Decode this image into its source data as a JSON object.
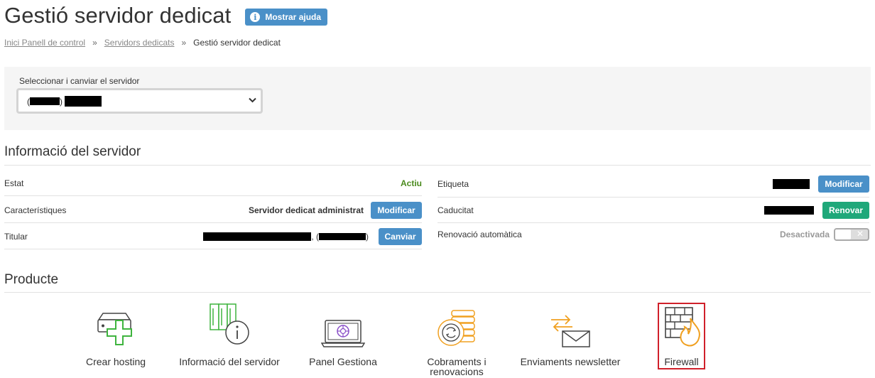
{
  "header": {
    "title": "Gestió servidor dedicat",
    "help_label": "Mostrar ajuda",
    "help_icon": "info-icon"
  },
  "breadcrumb": {
    "items": [
      "Inici Panell de control",
      "Servidors dedicats",
      "Gestió servidor dedicat"
    ],
    "separator": "»"
  },
  "server_selector": {
    "label": "Seleccionar i canviar el servidor",
    "value_prefix": "(",
    "value_close": ")"
  },
  "server_info": {
    "title": "Informació del servidor",
    "left": [
      {
        "label": "Estat",
        "value": "Actiu"
      },
      {
        "label": "Característiques",
        "value": "Servidor dedicat administrat",
        "button": "Modificar"
      },
      {
        "label": "Titular",
        "value_sep": ", (",
        "value_close": ")",
        "button": "Canviar"
      }
    ],
    "right": [
      {
        "label": "Etiqueta",
        "button": "Modificar"
      },
      {
        "label": "Caducitat",
        "button": "Renovar"
      },
      {
        "label": "Renovació automàtica",
        "value": "Desactivada",
        "toggle_symbol": "✕"
      }
    ]
  },
  "products": {
    "title": "Producte",
    "items": [
      {
        "label": "Crear hosting",
        "icon": "server-add-icon"
      },
      {
        "label": "Informació del servidor",
        "icon": "server-info-icon"
      },
      {
        "label": "Panel Gestiona",
        "icon": "laptop-panel-icon"
      },
      {
        "label_line1": "Cobraments i",
        "label_line2": "renovacions",
        "icon": "coins-icon"
      },
      {
        "label": "Enviaments newsletter",
        "icon": "newsletter-icon"
      },
      {
        "label": "Firewall",
        "icon": "firewall-icon"
      }
    ]
  },
  "colors": {
    "accent_blue": "#4a90c8",
    "renew_teal": "#1fa87a",
    "active_green": "#4a8a1d",
    "icon_green": "#3fb43f",
    "icon_orange": "#f0a020",
    "highlight_red": "#d0202a"
  }
}
